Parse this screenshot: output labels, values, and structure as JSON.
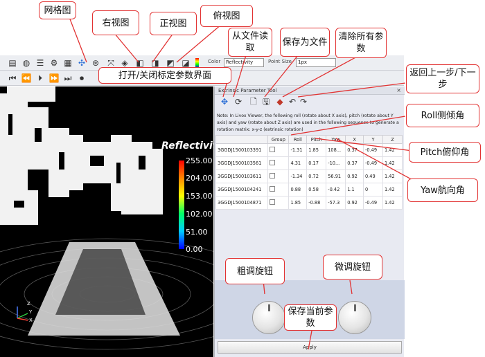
{
  "toolbar": {
    "color_label": "Color",
    "color_value": "Reflectivity",
    "point_size_label": "Point Size",
    "point_size_value": "1px"
  },
  "icons_row1": [
    "folder-icon",
    "globe-icon",
    "list-icon",
    "gear-icon",
    "grid-icon",
    "network-icon",
    "move-icon",
    "sphere-icon",
    "cube-right-icon",
    "cube-front-icon",
    "cube-top-icon",
    "cube-iso-icon",
    "cube-alt-icon",
    "color-bar-icon"
  ],
  "icons_row2": [
    "skip-start-icon",
    "rewind-icon",
    "play-icon",
    "forward-icon",
    "skip-end-icon",
    "record-icon"
  ],
  "panel": {
    "title": "Extrinsic Parameter Tool",
    "close": "×",
    "note": "Note: In Livox Viewer, the following roll (rotate about X axis), pitch (rotate about Y axis) and yaw (rotate about Z axis) are used in the following sequence to generate a rotation matrix: x-y-z (extrinsic rotation)",
    "columns": [
      "",
      "Group",
      "Roll",
      "Pitch",
      "Yaw",
      "X",
      "Y",
      "Z"
    ],
    "rows": [
      {
        "id": "3GGDJ1500103391",
        "roll": "-1.31",
        "pitch": "1.85",
        "yaw": "108...",
        "x": "0.37",
        "y": "-0.49",
        "z": "1.42"
      },
      {
        "id": "3GGDJ1500103561",
        "roll": "4.31",
        "pitch": "0.17",
        "yaw": "-10...",
        "x": "0.37",
        "y": "-0.49",
        "z": "1.42"
      },
      {
        "id": "3GGDJ1500103611",
        "roll": "-1.34",
        "pitch": "0.72",
        "yaw": "56.91",
        "x": "0.92",
        "y": "0.49",
        "z": "1.42"
      },
      {
        "id": "3GGDJ1500104241",
        "roll": "0.88",
        "pitch": "0.58",
        "yaw": "-0.42",
        "x": "1.1",
        "y": "0",
        "z": "1.42"
      },
      {
        "id": "3GGDJ1500104871",
        "roll": "1.85",
        "pitch": "-0.88",
        "yaw": "-57.3",
        "x": "0.92",
        "y": "-0.49",
        "z": "1.42"
      }
    ],
    "apply": "Apply"
  },
  "viewer": {
    "legend_title": "Reflectivity",
    "legend_ticks": [
      "255.00",
      "204.00",
      "153.00",
      "102.00",
      "51.00",
      "0.00"
    ],
    "axis_labels": [
      "Z",
      "Y",
      "X"
    ]
  },
  "callouts": {
    "grid_view": "网格图",
    "right_view": "右视图",
    "front_view": "正视图",
    "top_view": "俯视图",
    "read_file": "从文件读取",
    "save_file": "保存为文件",
    "clear_params": "清除所有参数",
    "toggle_panel": "打开/关闭标定参数界面",
    "undo_redo": "返回上一步/下一步",
    "roll": "Roll侧倾角",
    "pitch": "Pitch俯仰角",
    "yaw": "Yaw航向角",
    "coarse_knob": "粗调旋钮",
    "fine_knob": "微调旋钮",
    "save_current": "保存当前参数"
  },
  "colors": {
    "callout_border": "#e23333",
    "viewer_bg": "#000000",
    "panel_bg": "#e8eaf2",
    "knob_area_bg": "#cfd6e6"
  }
}
